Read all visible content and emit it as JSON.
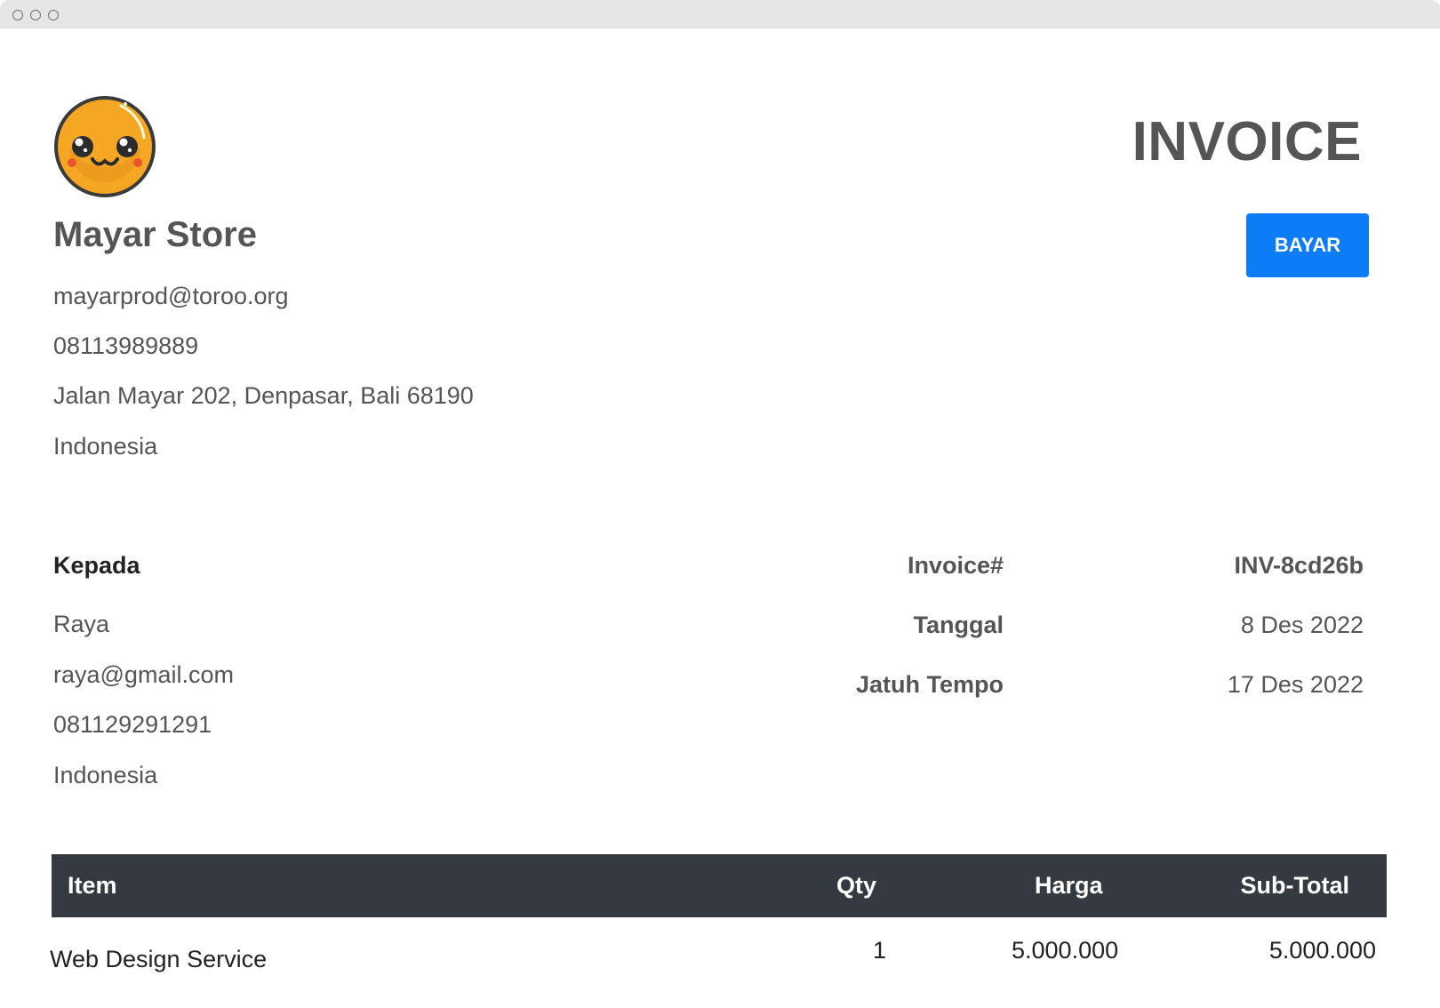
{
  "window": {
    "controls": [
      "close",
      "minimize",
      "maximize"
    ]
  },
  "store": {
    "logo_icon": "smiling-orange-face-icon",
    "name": "Mayar Store",
    "email": "mayarprod@toroo.org",
    "phone": "08113989889",
    "address": "Jalan Mayar 202, Denpasar, Bali 68190",
    "country": "Indonesia"
  },
  "header": {
    "title": "INVOICE",
    "pay_button_label": "BAYAR",
    "pay_button_color": "#0d7df7"
  },
  "recipient": {
    "heading": "Kepada",
    "name": "Raya",
    "email": "raya@gmail.com",
    "phone": "081129291291",
    "country": "Indonesia"
  },
  "meta": {
    "invoice_label": "Invoice#",
    "invoice_value": "INV-8cd26b",
    "date_label": "Tanggal",
    "date_value": "8 Des 2022",
    "due_label": "Jatuh Tempo",
    "due_value": "17 Des 2022"
  },
  "table": {
    "header_color": "#343a40",
    "columns": [
      "Item",
      "Qty",
      "Harga",
      "Sub-Total"
    ],
    "rows": [
      {
        "item": "Web Design Service",
        "qty": "1",
        "price": "5.000.000",
        "subtotal": "5.000.000"
      }
    ]
  }
}
